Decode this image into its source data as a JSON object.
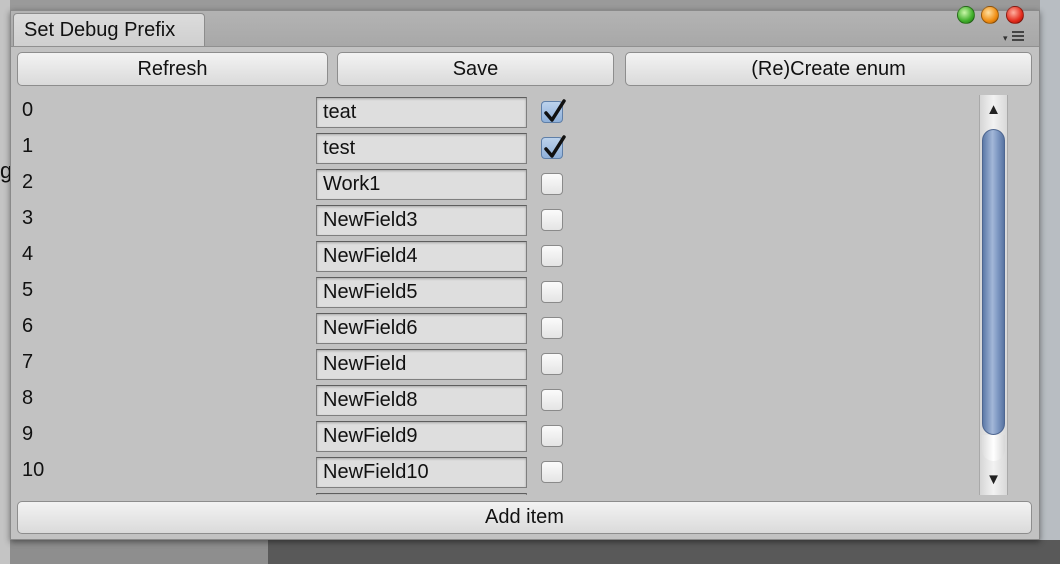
{
  "window": {
    "tab_title": "Set Debug Prefix"
  },
  "toolbar": {
    "refresh_label": "Refresh",
    "save_label": "Save",
    "create_enum_label": "(Re)Create enum"
  },
  "items": [
    {
      "index": "0",
      "value": "teat",
      "checked": true
    },
    {
      "index": "1",
      "value": "test",
      "checked": true
    },
    {
      "index": "2",
      "value": "Work1",
      "checked": false
    },
    {
      "index": "3",
      "value": "NewField3",
      "checked": false
    },
    {
      "index": "4",
      "value": "NewField4",
      "checked": false
    },
    {
      "index": "5",
      "value": "NewField5",
      "checked": false
    },
    {
      "index": "6",
      "value": "NewField6",
      "checked": false
    },
    {
      "index": "7",
      "value": "NewField",
      "checked": false
    },
    {
      "index": "8",
      "value": "NewField8",
      "checked": false
    },
    {
      "index": "9",
      "value": "NewField9",
      "checked": false
    },
    {
      "index": "10",
      "value": "NewField10",
      "checked": false
    }
  ],
  "footer": {
    "add_item_label": "Add item"
  },
  "icons": {
    "window_controls": [
      "green-light-icon",
      "yellow-light-icon",
      "red-light-icon"
    ],
    "tab_menu": "tab-menu-icon",
    "scroll_up": "scroll-up-arrow-icon",
    "scroll_down": "scroll-down-arrow-icon",
    "check": "checkmark-icon"
  },
  "colors": {
    "window_bg": "#c2c2c2",
    "scroll_thumb": "#7f99c3",
    "checkbox_checked": "#8fb0d9"
  }
}
